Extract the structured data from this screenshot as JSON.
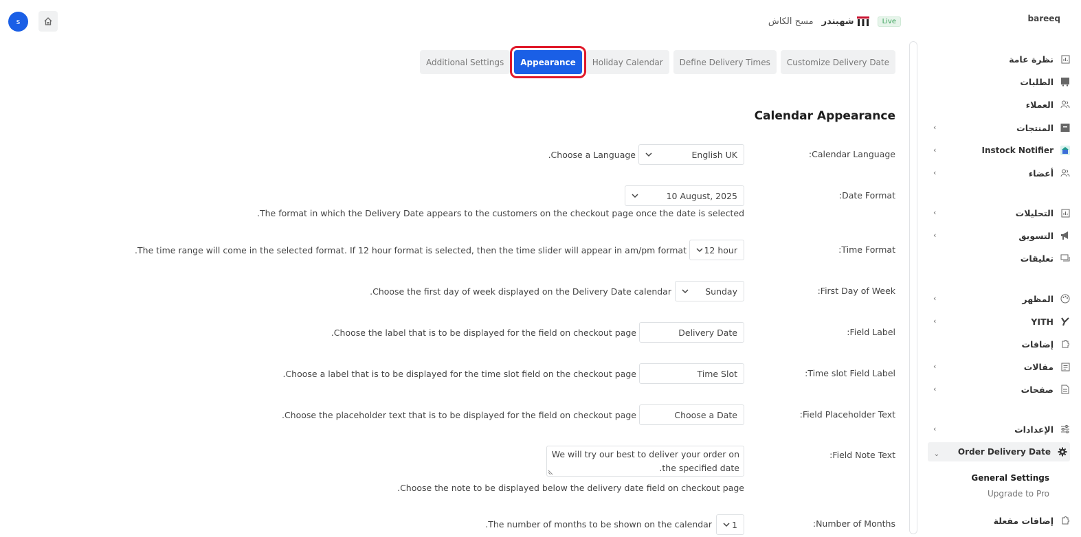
{
  "topbar": {
    "avatar_letter": "s",
    "cache_clear": "مسح الكاش",
    "store_name": "شهبندر",
    "live_badge": "Live",
    "brand": "bareeq"
  },
  "sidebar": {
    "items": [
      {
        "label": "نظرة عامة",
        "icon": "chart-icon"
      },
      {
        "label": "الطلبات",
        "icon": "orders-cart-icon"
      },
      {
        "label": "العملاء",
        "icon": "customers-icon"
      },
      {
        "label": "المنتجات",
        "icon": "products-box-icon"
      },
      {
        "label": "Instock Notifier",
        "icon": "bell-store-icon"
      },
      {
        "label": "أعضاء",
        "icon": "members-icon"
      },
      {
        "label": "التحليلات",
        "icon": "analytics-icon"
      },
      {
        "label": "التسويق",
        "icon": "megaphone-icon"
      },
      {
        "label": "تعليقات",
        "icon": "comments-icon"
      },
      {
        "label": "المظهر",
        "icon": "palette-icon"
      },
      {
        "label": "YITH",
        "icon": "yith-icon"
      },
      {
        "label": "إضافات",
        "icon": "plugin-icon"
      },
      {
        "label": "مقالات",
        "icon": "posts-icon"
      },
      {
        "label": "صفحات",
        "icon": "pages-icon"
      },
      {
        "label": "الإعدادات",
        "icon": "settings-sliders-icon"
      },
      {
        "label": "Order Delivery Date",
        "icon": "gear-icon"
      },
      {
        "label": "إضافات مفعلة",
        "icon": "plugin-icon"
      }
    ],
    "sub_items": [
      "General Settings",
      "Upgrade to Pro"
    ]
  },
  "tabs": [
    "Customize Delivery Date",
    "Define Delivery Times",
    "Holiday Calendar",
    "Appearance",
    "Additional Settings"
  ],
  "section_title": "Calendar Appearance",
  "settings": {
    "calendar_language": {
      "label": ":Calendar Language",
      "value": "English UK",
      "desc": ".Choose a Language"
    },
    "date_format": {
      "label": ":Date Format",
      "value": "10 August, 2025",
      "desc": ".The format in which the Delivery Date appears to the customers on the checkout page once the date is selected"
    },
    "time_format": {
      "label": ":Time Format",
      "value": "12 hour",
      "desc": ".The time range will come in the selected format. If 12 hour format is selected, then the time slider will appear in am/pm format"
    },
    "first_day": {
      "label": ":First Day of Week",
      "value": "Sunday",
      "desc": ".Choose the first day of week displayed on the Delivery Date calendar"
    },
    "field_label": {
      "label": ":Field Label",
      "value": "Delivery Date",
      "desc": ".Choose the label that is to be displayed for the field on checkout page"
    },
    "timeslot_label": {
      "label": ":Time slot Field Label",
      "value": "Time Slot",
      "desc": ".Choose a label that is to be displayed for the time slot field on the checkout page"
    },
    "placeholder": {
      "label": ":Field Placeholder Text",
      "value": "Choose a Date",
      "desc": ".Choose the placeholder text that is to be displayed for the field on checkout page"
    },
    "note": {
      "label": ":Field Note Text",
      "value": "We will try our best to deliver your order on the specified date.",
      "line1": "We will try our best to deliver your order on",
      "line2": ".the specified date",
      "desc": ".Choose the note to be displayed below the delivery date field on checkout page"
    },
    "months": {
      "label": ":Number of Months",
      "value": "1",
      "desc": ".The number of months to be shown on the calendar"
    }
  },
  "colors": {
    "accent": "#1a5fe6",
    "highlight": "#e0192a",
    "live": "#37a157"
  }
}
